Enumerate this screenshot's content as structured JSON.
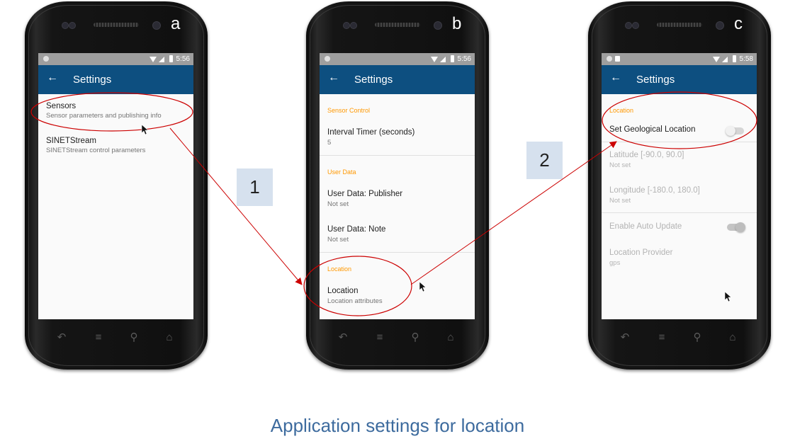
{
  "phones": [
    {
      "letter": "a",
      "status_time": "5:56",
      "appbar_title": "Settings",
      "items": [
        {
          "title": "Sensors",
          "subtitle": "Sensor parameters and publishing info"
        },
        {
          "title": "SINETStream",
          "subtitle": "SINETStream control parameters"
        }
      ]
    },
    {
      "letter": "b",
      "status_time": "5:56",
      "appbar_title": "Settings",
      "categories": [
        "Sensor Control",
        "User Data",
        "Location"
      ],
      "items": [
        {
          "title": "Interval Timer (seconds)",
          "subtitle": "5"
        },
        {
          "title": "User Data: Publisher",
          "subtitle": "Not set"
        },
        {
          "title": "User Data: Note",
          "subtitle": "Not set"
        },
        {
          "title": "Location",
          "subtitle": "Location attributes"
        }
      ]
    },
    {
      "letter": "c",
      "status_time": "5:58",
      "appbar_title": "Settings",
      "category": "Location",
      "items": [
        {
          "title": "Set Geological Location",
          "toggle": "off"
        },
        {
          "title": "Latitude [-90.0, 90.0]",
          "subtitle": "Not set",
          "enabled": false
        },
        {
          "title": "Longitude [-180.0, 180.0]",
          "subtitle": "Not set",
          "enabled": false
        },
        {
          "title": "Enable Auto Update",
          "toggle": "on",
          "enabled": false
        },
        {
          "title": "Location Provider",
          "subtitle": "gps",
          "enabled": false
        }
      ]
    }
  ],
  "steps": [
    "1",
    "2"
  ],
  "caption": "Application settings for location",
  "colors": {
    "appbar": "#0d4f80",
    "category": "#ff9800",
    "annotation": "#cc0000",
    "step_box": "#d6e1ee",
    "caption": "#3d6b9e"
  },
  "icons": {
    "back": "arrow-left-icon",
    "nav": [
      "back-nav-icon",
      "menu-nav-icon",
      "search-nav-icon",
      "home-nav-icon"
    ]
  }
}
